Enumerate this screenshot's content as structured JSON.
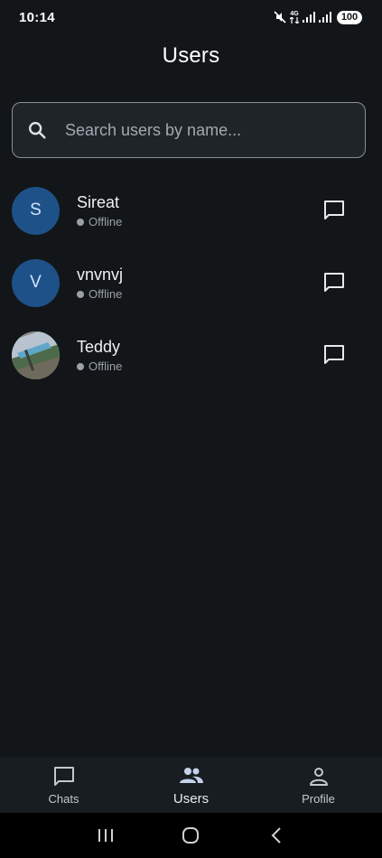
{
  "status_bar": {
    "time": "10:14",
    "network_label": "4G",
    "battery": "100"
  },
  "header": {
    "title": "Users"
  },
  "search": {
    "placeholder": "Search users by name...",
    "value": ""
  },
  "users": [
    {
      "name": "Sireat",
      "initial": "S",
      "status": "Offline",
      "avatar_type": "initial"
    },
    {
      "name": "vnvnvj",
      "initial": "V",
      "status": "Offline",
      "avatar_type": "initial"
    },
    {
      "name": "Teddy",
      "initial": "",
      "status": "Offline",
      "avatar_type": "photo"
    }
  ],
  "bottom_nav": {
    "items": [
      {
        "label": "Chats",
        "icon": "chat-bubble-icon",
        "active": false
      },
      {
        "label": "Users",
        "icon": "people-icon",
        "active": true
      },
      {
        "label": "Profile",
        "icon": "person-icon",
        "active": false
      }
    ]
  },
  "colors": {
    "background": "#121619",
    "avatar": "#1e5188",
    "offline_dot": "#9aa0a6"
  }
}
